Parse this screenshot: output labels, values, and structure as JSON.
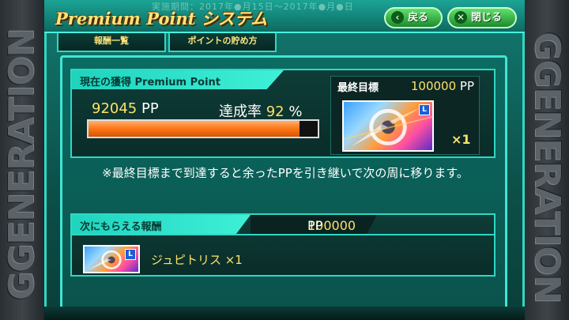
{
  "side": {
    "left_text": "GGENERATION",
    "right_text": "GGENERATION"
  },
  "header": {
    "title": "Premium Point システム",
    "back_label": "戻る",
    "close_label": "閉じる",
    "overlay_text": "実施期間：2017年●月15日～2017年●月●日"
  },
  "tabs": [
    {
      "label": "報酬一覧"
    },
    {
      "label": "ポイントの貯め方"
    }
  ],
  "current": {
    "header": "現在の獲得 Premium Point",
    "points": "92045",
    "unit": "PP",
    "rate_label": "達成率",
    "rate": "92",
    "rate_unit": "%",
    "progress_fraction": 0.92
  },
  "goal": {
    "label": "最終目標",
    "value": "100000",
    "unit": "PP",
    "multiplier": "×1",
    "badge": "L"
  },
  "note": "※最終目標まで到達すると余ったPPを引き継いで次の周に移ります。",
  "next": {
    "header": "次にもらえる報酬",
    "value": "100000",
    "unit": "PP",
    "item": "ジュピトリス ×1",
    "badge": "L"
  },
  "colors": {
    "accent": "#3fe6d3",
    "highlight": "#ffe16a",
    "button": "#2fae3a",
    "bar": "#ff7a1a"
  }
}
